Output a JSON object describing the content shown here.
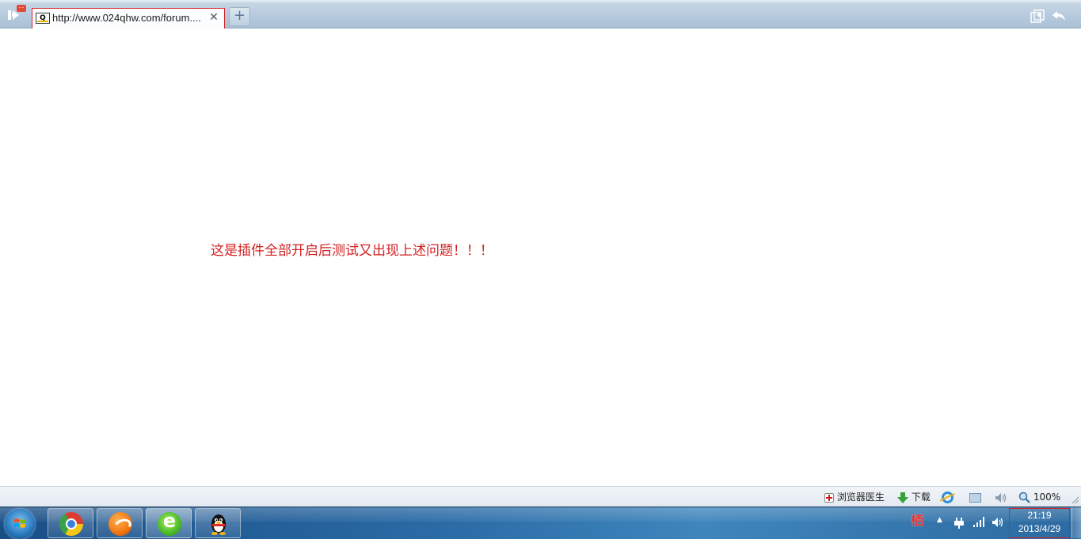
{
  "browser": {
    "sidebar_badge": "···",
    "tab": {
      "favicon_text": "Q",
      "title": "http://www.024qhw.com/forum....",
      "close_glyph": "✕"
    },
    "new_tab_glyph": "+"
  },
  "page": {
    "message": "这是插件全部开启后测试又出现上述问题！！！"
  },
  "statusbar": {
    "doctor_label": "浏览器医生",
    "download_label": "下载",
    "zoom_label": "100%"
  },
  "taskbar": {
    "apps": [
      "chrome",
      "maxthon",
      "browser-e",
      "qq"
    ],
    "tray": {
      "ime_glyph": "栖",
      "overflow_glyph": "▲",
      "time": "21:19",
      "date": "2013/4/29"
    }
  },
  "colors": {
    "message": "#d21f1f",
    "tab_highlight": "#d0252a",
    "taskbar": "#2a6aa5"
  }
}
